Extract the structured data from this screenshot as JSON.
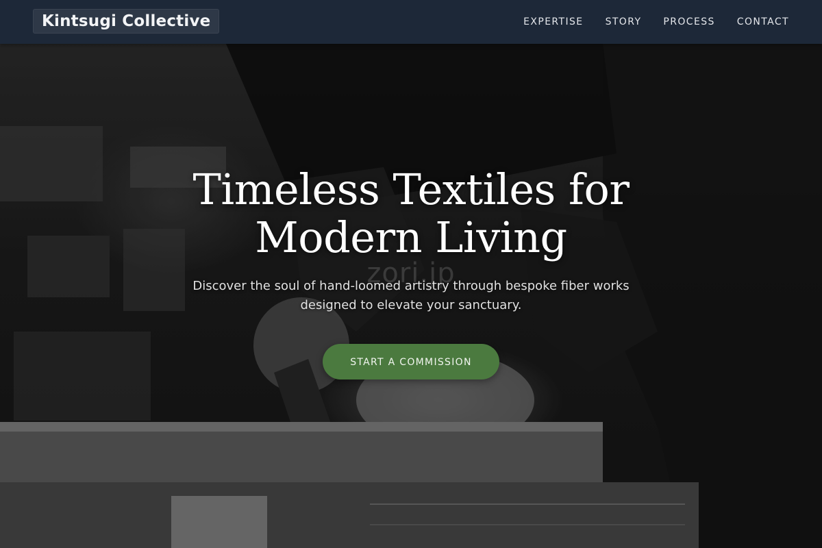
{
  "nav": {
    "brand": "Kintsugi Collective",
    "links": [
      "EXPERTISE",
      "STORY",
      "PROCESS",
      "CONTACT"
    ]
  },
  "hero": {
    "title_line1": "Timeless Textiles for",
    "title_line2": "Modern Living",
    "subtitle": "Discover the soul of hand-loomed artistry through bespoke fiber works designed to elevate your sanctuary.",
    "cta_label": "START A COMMISSION",
    "watermark": "zori.jp"
  },
  "colors": {
    "navbar_bg": "#1d2838",
    "cta_bg": "#4b7a3f",
    "text": "#ffffff"
  }
}
